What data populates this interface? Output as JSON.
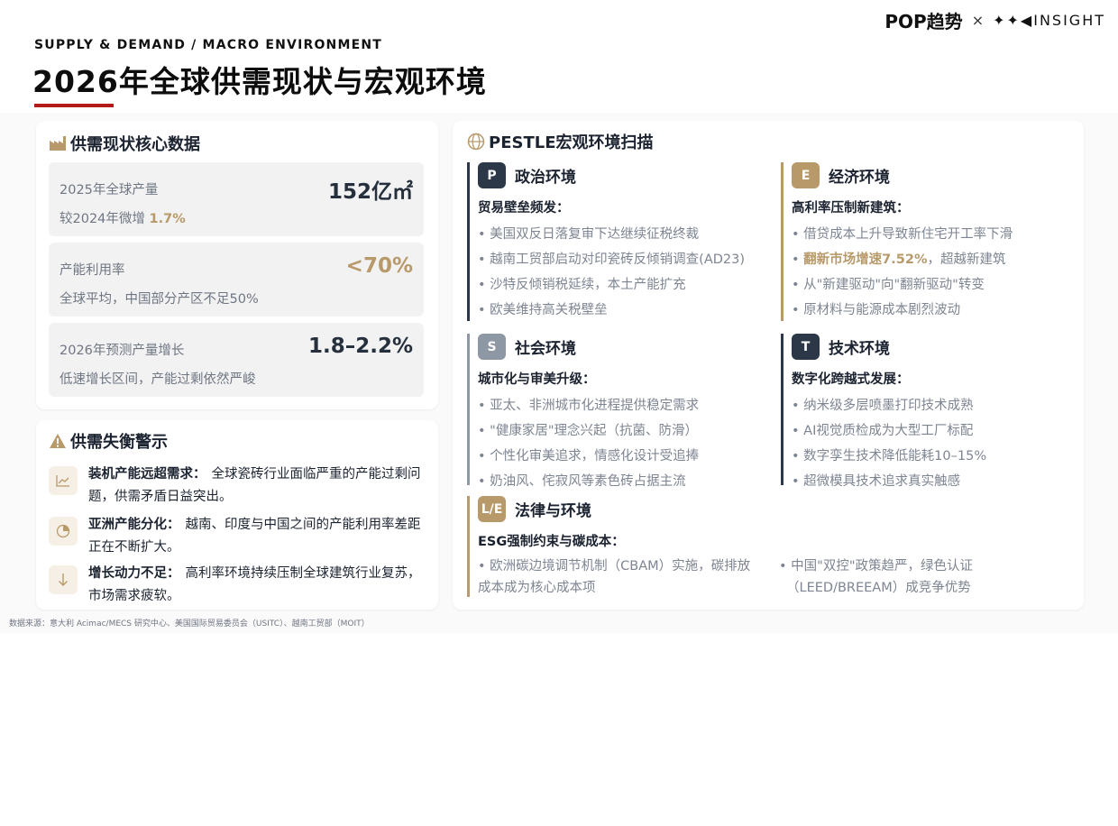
{
  "header": {
    "brand_left": "POP趋势",
    "brand_separator": "×",
    "brand_right": "✦✦◀INSIGHT",
    "eyebrow": "SUPPLY & DEMAND / MACRO ENVIRONMENT",
    "title": "2026年全球供需现状与宏观环境"
  },
  "colors": {
    "accent_red": "#b31b1b",
    "gold": "#b89a6a",
    "navy": "#2c3847",
    "slate": "#8e97a4"
  },
  "supply": {
    "title": "供需现状核心数据",
    "icon": "factory-icon",
    "stats": [
      {
        "label": "2025年全球产量",
        "value": "152亿㎡",
        "sub_prefix": "较2024年微增 ",
        "sub_highlight": "1.7%"
      },
      {
        "label": "产能利用率",
        "value": "<70%",
        "sub": "全球平均，中国部分产区不足50%"
      },
      {
        "label": "2026年预测产量增长",
        "value": "1.8–2.2%",
        "sub": "低速增长区间，产能过剩依然严峻"
      }
    ]
  },
  "warnings": {
    "title": "供需失衡警示",
    "icon": "warning-icon",
    "items": [
      {
        "icon": "trend-chart-icon",
        "bold": "装机产能远超需求：",
        "text": "全球瓷砖行业面临严重的产能过剩问题，供需矛盾日益突出。"
      },
      {
        "icon": "pie-chart-icon",
        "bold": "亚洲产能分化：",
        "text": "越南、印度与中国之间的产能利用率差距正在不断扩大。"
      },
      {
        "icon": "arrow-down-icon",
        "bold": "增长动力不足：",
        "text": "高利率环境持续压制全球建筑行业复苏，市场需求疲软。"
      }
    ]
  },
  "pestle": {
    "title": "PESTLE宏观环境扫描",
    "icon": "globe-icon",
    "political": {
      "badge": "P",
      "label": "政治环境",
      "sub": "贸易壁垒频发：",
      "items": [
        "美国双反日落复审下达继续征税终裁",
        "越南工贸部启动对印瓷砖反倾销调查(AD23)",
        "沙特反倾销税延续，本土产能扩充",
        "欧美维持高关税壁垒"
      ]
    },
    "economic": {
      "badge": "E",
      "label": "经济环境",
      "sub": "高利率压制新建筑：",
      "items_before": [
        "借贷成本上升导致新住宅开工率下滑"
      ],
      "highlight": "翻新市场增速7.52%",
      "highlight_rest": "，超越新建筑",
      "items_after": [
        "从\"新建驱动\"向\"翻新驱动\"转变",
        "原材料与能源成本剧烈波动"
      ]
    },
    "social": {
      "badge": "S",
      "label": "社会环境",
      "sub": "城市化与审美升级：",
      "items": [
        "亚太、非洲城市化进程提供稳定需求",
        "\"健康家居\"理念兴起（抗菌、防滑）",
        "个性化审美追求，情感化设计受追捧",
        "奶油风、侘寂风等素色砖占据主流"
      ]
    },
    "technology": {
      "badge": "T",
      "label": "技术环境",
      "sub": "数字化跨越式发展：",
      "items": [
        "纳米级多层喷墨打印技术成熟",
        "AI视觉质检成为大型工厂标配",
        "数字孪生技术降低能耗10–15%",
        "超微模具技术追求真实触感"
      ]
    },
    "legal": {
      "badge": "L/E",
      "label": "法律与环境",
      "sub": "ESG强制约束与碳成本：",
      "col1_line1": "• 欧洲碳边境调节机制（CBAM）实施，碳排放",
      "col1_line2": "成本成为核心成本项",
      "col2_line1": "• 中国\"双控\"政策趋严，绿色认证",
      "col2_line2": "（LEED/BREEAM）成竞争优势"
    }
  },
  "footnote": "数据来源：意大利 Acimac/MECS 研究中心、美国国际贸易委员会（USITC）、越南工贸部（MOIT）"
}
